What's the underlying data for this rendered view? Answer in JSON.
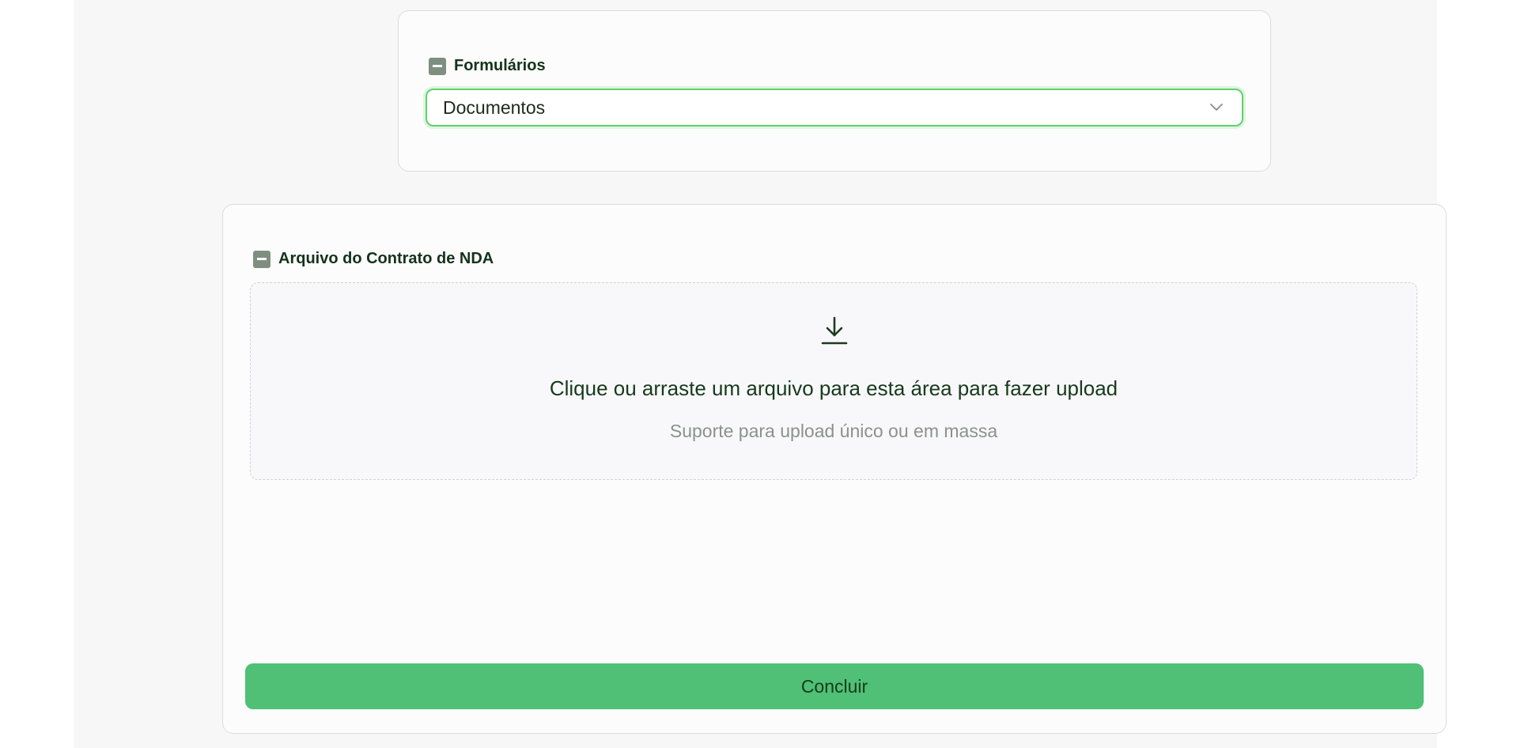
{
  "forms_section": {
    "label": "Formulários",
    "select": {
      "selected_value": "Documentos"
    }
  },
  "upload_section": {
    "label": "Arquivo do Contrato de NDA",
    "dropzone": {
      "icon": "download-icon",
      "title": "Clique ou arraste um arquivo para esta área para fazer upload",
      "subtitle": "Suporte para upload único ou em massa"
    },
    "submit_label": "Concluir"
  },
  "colors": {
    "accent_green": "#4fc076",
    "focus_border": "#5fd36a",
    "label_text": "#14331a",
    "collapse_icon": "#7f8f7f"
  }
}
